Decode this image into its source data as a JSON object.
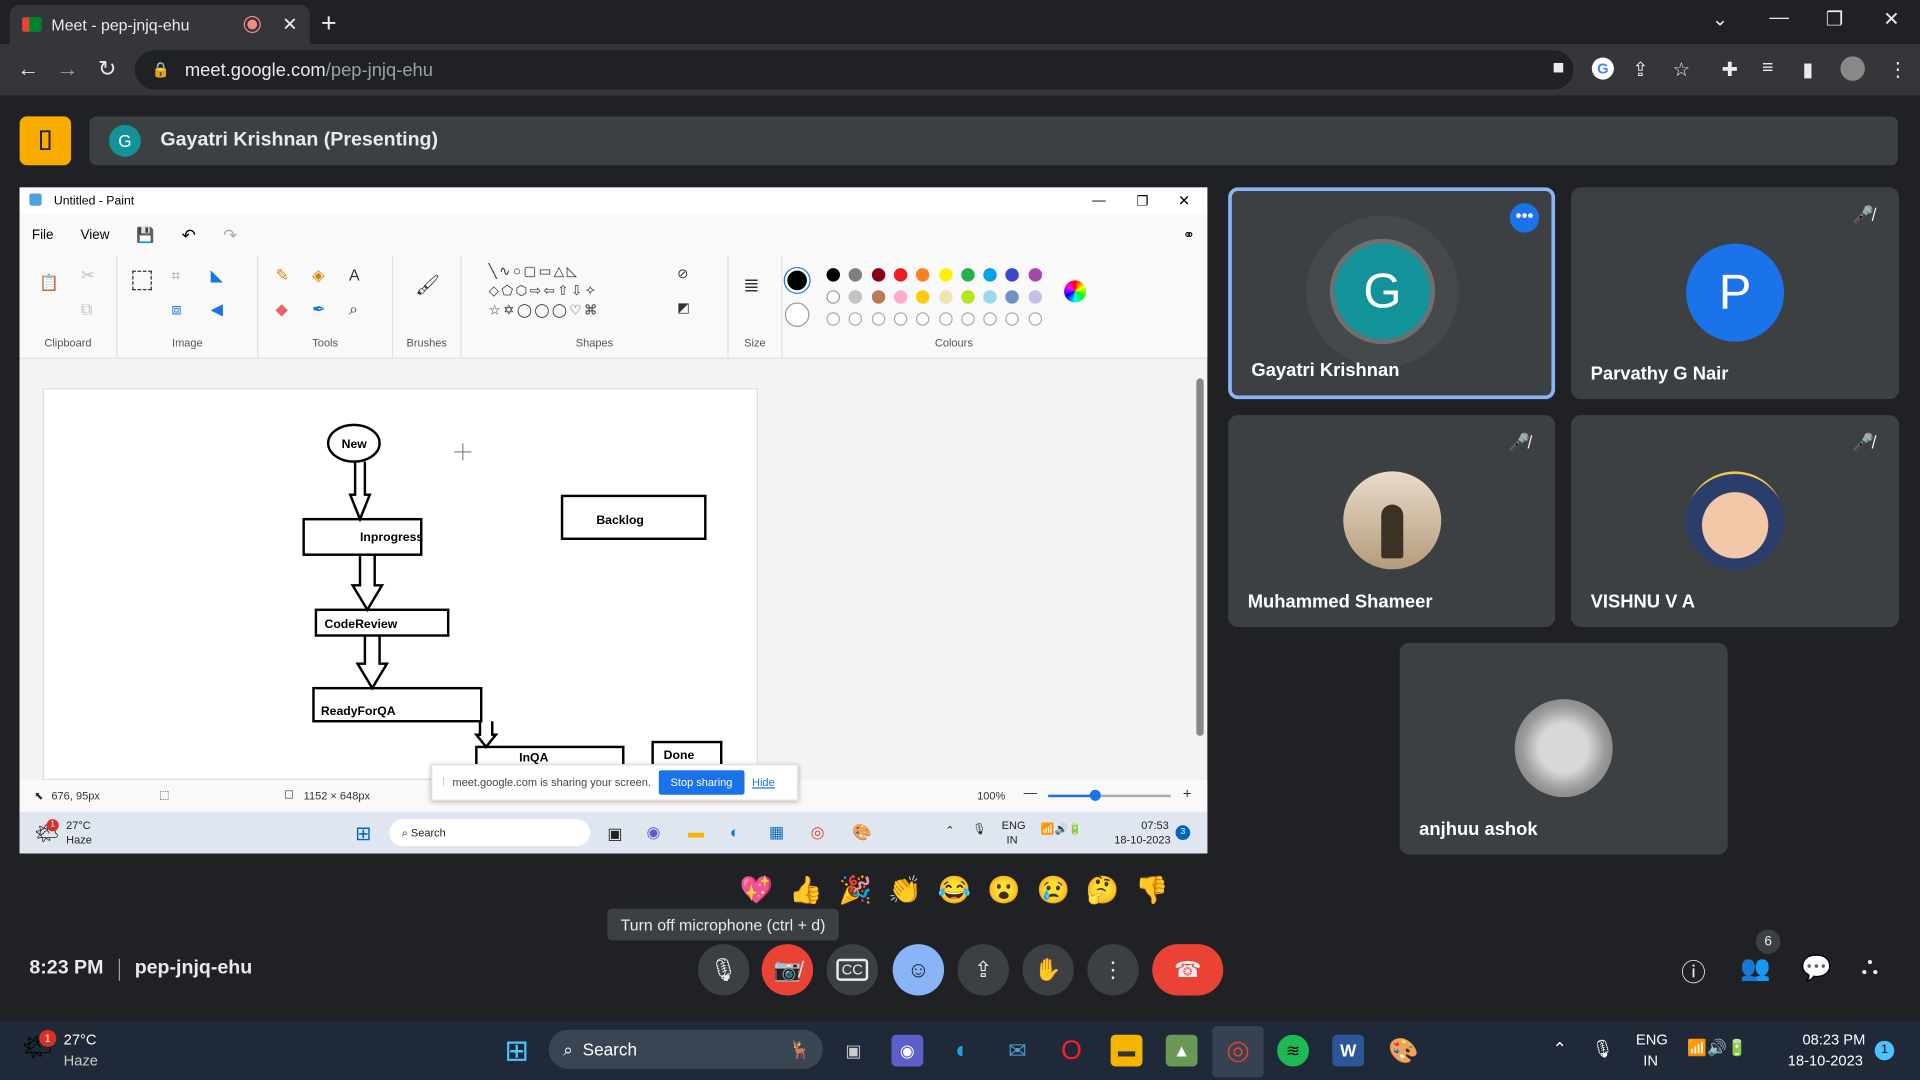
{
  "browser": {
    "tab_title": "Meet - pep-jnjq-ehu",
    "url_host": "meet.google.com",
    "url_path": "/pep-jnjq-ehu"
  },
  "presenter_bar": {
    "avatar_letter": "G",
    "label": "Gayatri Krishnan (Presenting)"
  },
  "paint": {
    "window_title": "Untitled - Paint",
    "menu": [
      "File",
      "View"
    ],
    "groups": [
      "Clipboard",
      "Image",
      "Tools",
      "Brushes",
      "Shapes",
      "Size",
      "Colours"
    ],
    "diagram_boxes": [
      "New",
      "Inprogress",
      "Backlog",
      "CodeReview",
      "ReadyForQA",
      "InQA",
      "Done"
    ],
    "status_cursor": "676, 95px",
    "status_size": "1152 × 648px",
    "zoom": "100%",
    "share_banner_text": "meet.google.com is sharing your screen.",
    "stop_sharing": "Stop sharing",
    "hide": "Hide",
    "taskbar": {
      "weather_temp": "27°C",
      "weather_desc": "Haze",
      "search": "Search",
      "lang1": "ENG",
      "lang2": "IN",
      "time": "07:53",
      "date": "18-10-2023",
      "notif": "3",
      "weather_badge": "1"
    },
    "palette": [
      "#000000",
      "#7f7f7f",
      "#880015",
      "#ed1c24",
      "#ff7f27",
      "#fff200",
      "#22b14c",
      "#00a2e8",
      "#3f48cc",
      "#a349a4",
      "#ffffff",
      "#c3c3c3",
      "#b97a57",
      "#ffaec9",
      "#ffc90e",
      "#efe4b0",
      "#b5e61d",
      "#99d9ea",
      "#7092be",
      "#c8bfe7"
    ]
  },
  "participants": [
    {
      "name": "Gayatri Krishnan",
      "letter": "G",
      "color": "#12939a"
    },
    {
      "name": "Parvathy G Nair",
      "letter": "P",
      "color": "#1a73e8"
    },
    {
      "name": "Muhammed Shameer"
    },
    {
      "name": "VISHNU V A"
    },
    {
      "name": "anjhuu ashok"
    }
  ],
  "reactions": [
    "💖",
    "👍",
    "🎉",
    "👏",
    "😂",
    "😮",
    "😢",
    "🤔",
    "👎"
  ],
  "tooltip": "Turn off microphone (ctrl + d)",
  "bottom": {
    "time": "8:23 PM",
    "meeting_code": "pep-jnjq-ehu",
    "people_count": "6"
  },
  "windows_taskbar": {
    "weather_temp": "27°C",
    "weather_desc": "Haze",
    "weather_badge": "1",
    "search": "Search",
    "lang1": "ENG",
    "lang2": "IN",
    "time": "08:23 PM",
    "date": "18-10-2023",
    "notif": "1"
  }
}
